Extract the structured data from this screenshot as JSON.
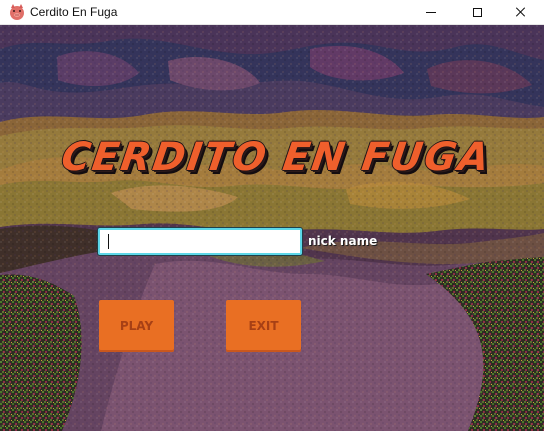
{
  "window": {
    "title": "Cerdito En Fuga",
    "app_icon": "pig-icon",
    "controls": {
      "minimize_icon": "minimize-icon",
      "maximize_icon": "maximize-icon",
      "close_icon": "close-icon"
    }
  },
  "game": {
    "title": "CERDITO EN FUGA",
    "nickname": {
      "value": "",
      "label": "nick name"
    },
    "buttons": {
      "play": "PLAY",
      "exit": "EXIT"
    }
  },
  "colors": {
    "title": "#ef5f2c",
    "button": "#e96f23",
    "button_text": "#a74015",
    "input_border": "#5dd7e8"
  }
}
